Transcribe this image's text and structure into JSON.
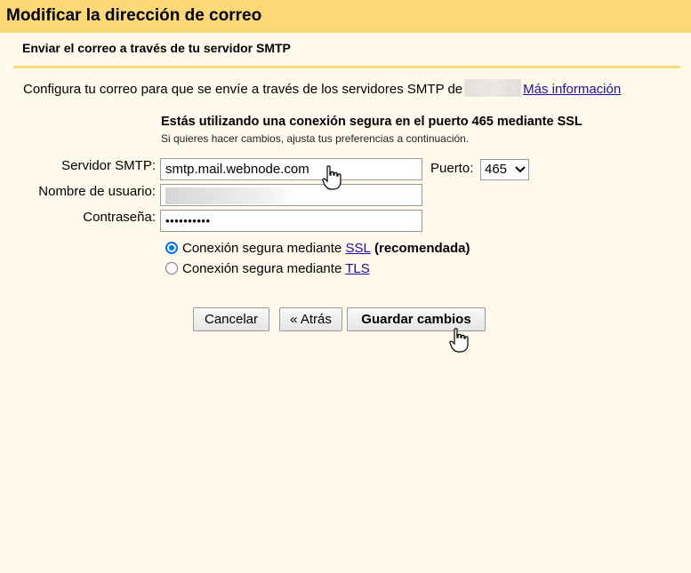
{
  "dialog": {
    "title": "Modificar la dirección de correo",
    "section_title": "Enviar el correo a través de tu servidor SMTP",
    "intro_text": "Configura tu correo para que se envíe a través de los servidores SMTP de",
    "more_info_link": "Más información"
  },
  "secure_notice": {
    "heading": "Estás utilizando una conexión segura en el puerto 465 mediante SSL",
    "subtext": "Si quieres hacer cambios, ajusta tus preferencias a continuación."
  },
  "form": {
    "smtp_label": "Servidor SMTP:",
    "smtp_value": "smtp.mail.webnode.com",
    "port_label": "Puerto:",
    "port_value": "465",
    "username_label": "Nombre de usuario:",
    "password_label": "Contraseña:",
    "password_value": "••••••••••"
  },
  "connection_options": {
    "ssl_prefix": "Conexión segura mediante ",
    "ssl_link": "SSL",
    "ssl_suffix": " (recomendada)",
    "tls_prefix": "Conexión segura mediante ",
    "tls_link": "TLS",
    "selected": "SSL"
  },
  "buttons": {
    "cancel": "Cancelar",
    "back": "« Atrás",
    "save": "Guardar cambios"
  },
  "colors": {
    "header_bg": "#fbd977",
    "panel_bg": "#fffaeb",
    "link": "#1a0dab",
    "radio_accent": "#0075ff"
  },
  "icons": {
    "pointer_cursor_1": "hand-pointer-icon",
    "pointer_cursor_2": "hand-pointer-icon"
  }
}
